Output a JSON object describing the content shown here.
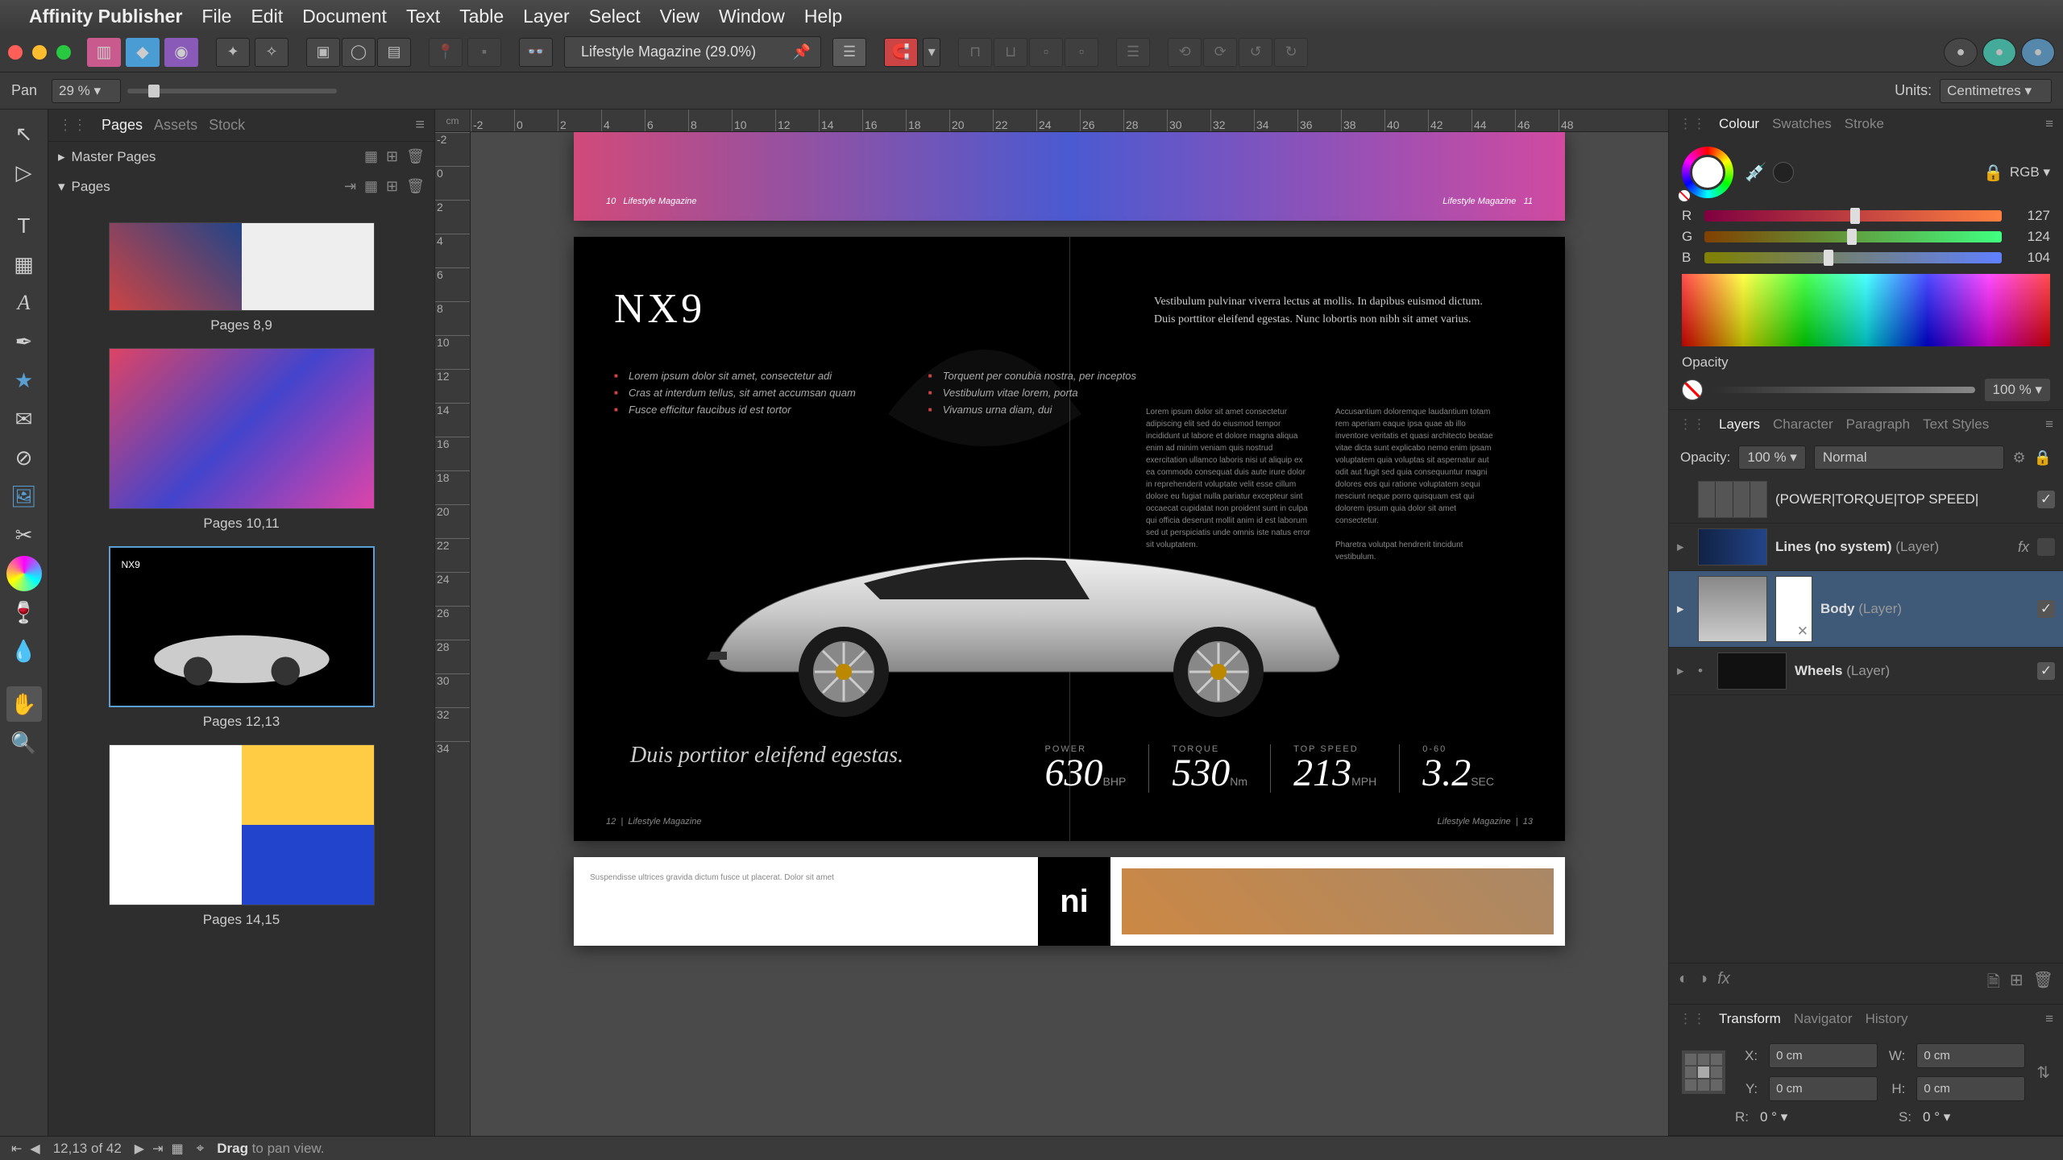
{
  "menubar": {
    "app": "Affinity Publisher",
    "items": [
      "File",
      "Edit",
      "Document",
      "Text",
      "Table",
      "Layer",
      "Select",
      "View",
      "Window",
      "Help"
    ]
  },
  "toolbar": {
    "doc_title": "Lifestyle Magazine (29.0%)"
  },
  "context": {
    "tool_label": "Pan",
    "zoom": "29 %",
    "units_label": "Units:",
    "units_value": "Centimetres"
  },
  "ruler_h": [
    "cm",
    "-2",
    "0",
    "2",
    "4",
    "6",
    "8",
    "10",
    "12",
    "14",
    "16",
    "18",
    "20",
    "22",
    "24",
    "26",
    "28",
    "30",
    "32",
    "34",
    "36",
    "38",
    "40",
    "42",
    "44",
    "46",
    "48"
  ],
  "ruler_v": [
    "-2",
    "0",
    "2",
    "4",
    "6",
    "8",
    "10",
    "12",
    "14",
    "16",
    "18",
    "20",
    "22",
    "24",
    "26",
    "28",
    "30",
    "32",
    "34"
  ],
  "pages_panel": {
    "tabs": [
      "Pages",
      "Assets",
      "Stock"
    ],
    "master_label": "Master Pages",
    "pages_label": "Pages",
    "spreads": [
      {
        "label": "Pages 8,9"
      },
      {
        "label": "Pages 10,11"
      },
      {
        "label": "Pages 12,13",
        "selected": true
      },
      {
        "label": "Pages 14,15"
      }
    ]
  },
  "spread": {
    "headline": "NX9",
    "intro": "Vestibulum pulvinar viverra lectus at mollis. In dapibus euismod dictum. Duis porttitor eleifend egestas. Nunc lobortis non nibh sit amet varius.",
    "bullets_a": [
      "Lorem ipsum dolor sit amet, consectetur adi",
      "Cras at interdum tellus, sit amet accumsan quam",
      "Fusce efficitur faucibus id est tortor"
    ],
    "bullets_b": [
      "Torquent per conubia nostra, per inceptos",
      "Vestibulum vitae lorem, porta",
      "Vivamus urna diam, dui"
    ],
    "tagline": "Duis portitor eleifend egestas.",
    "stats": [
      {
        "label": "POWER",
        "value": "630",
        "unit": "BHP"
      },
      {
        "label": "TORQUE",
        "value": "530",
        "unit": "Nm"
      },
      {
        "label": "TOP SPEED",
        "value": "213",
        "unit": "MPH"
      },
      {
        "label": "0-60",
        "value": "3.2",
        "unit": "SEC"
      }
    ],
    "footer_left": "12",
    "footer_mag": "Lifestyle Magazine",
    "footer_right": "13"
  },
  "colour_panel": {
    "tabs": [
      "Colour",
      "Swatches",
      "Stroke"
    ],
    "mode": "RGB",
    "r": {
      "label": "R",
      "value": "127"
    },
    "g": {
      "label": "G",
      "value": "124"
    },
    "b": {
      "label": "B",
      "value": "104"
    },
    "opacity_label": "Opacity",
    "opacity_value": "100 %"
  },
  "layers_panel": {
    "tabs": [
      "Layers",
      "Character",
      "Paragraph",
      "Text Styles"
    ],
    "opacity_label": "Opacity:",
    "opacity_value": "100 %",
    "blend": "Normal",
    "rows": [
      {
        "name": "(POWER|TORQUE|TOP SPEED|",
        "type": "",
        "icon": "table",
        "checked": true
      },
      {
        "name": "Lines (no system)",
        "type": "(Layer)",
        "fx": true,
        "checked": false,
        "exp": true
      },
      {
        "name": "Body",
        "type": "(Layer)",
        "checked": true,
        "sel": true,
        "tall": true,
        "mask": true
      },
      {
        "name": "Wheels",
        "type": "(Layer)",
        "checked": true,
        "exp": true
      }
    ]
  },
  "transform_panel": {
    "tabs": [
      "Transform",
      "Navigator",
      "History"
    ],
    "x": {
      "label": "X:",
      "value": "0 cm"
    },
    "y": {
      "label": "Y:",
      "value": "0 cm"
    },
    "w": {
      "label": "W:",
      "value": "0 cm"
    },
    "h": {
      "label": "H:",
      "value": "0 cm"
    },
    "r": {
      "label": "R:",
      "value": "0 °"
    },
    "s": {
      "label": "S:",
      "value": "0 °"
    }
  },
  "status": {
    "page_info": "12,13 of 42",
    "hint_bold": "Drag",
    "hint_rest": " to pan view."
  }
}
